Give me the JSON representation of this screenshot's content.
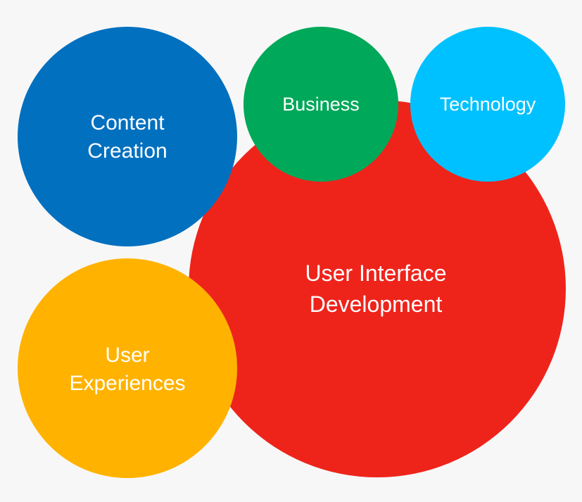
{
  "diagram": {
    "background": "#f7f7f7",
    "bubbles": [
      {
        "id": "user-interface-development",
        "label": "User Interface\nDevelopment",
        "color": "#ee241b"
      },
      {
        "id": "content-creation",
        "label": "Content\nCreation",
        "color": "#0070bf"
      },
      {
        "id": "business",
        "label": "Business",
        "color": "#00a859"
      },
      {
        "id": "technology",
        "label": "Technology",
        "color": "#00c1ff"
      },
      {
        "id": "user-experiences",
        "label": "User\nExperiences",
        "color": "#ffb300"
      }
    ]
  }
}
